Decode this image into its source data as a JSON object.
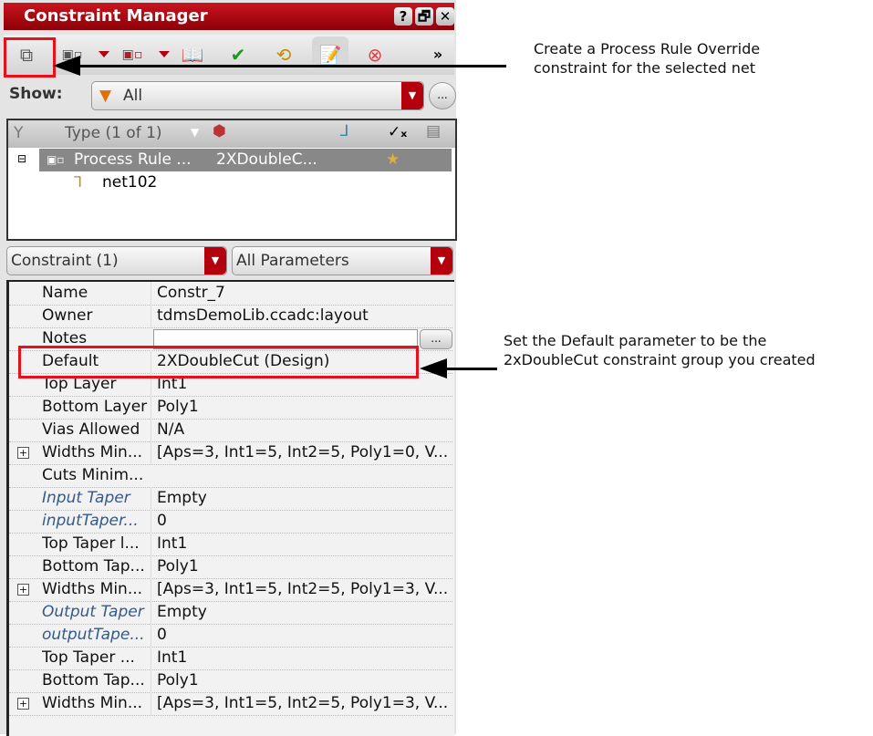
{
  "window": {
    "title": "Constraint Manager",
    "buttons": [
      "?",
      "🗗",
      "✕"
    ]
  },
  "toolbar": {
    "items": [
      "copy-constraint-icon",
      "constraint-group-icon",
      "constraint-group-alt-icon",
      "book-icon",
      "check-icon",
      "refresh-icon",
      "edit-icon",
      "cancel-icon"
    ],
    "overflow": "»"
  },
  "show": {
    "label": "Show:",
    "value": "All",
    "ellipsis": "..."
  },
  "tree": {
    "header": {
      "type": "Type (1 of 1)"
    },
    "row": {
      "type": "Process Rule ...",
      "value": "2XDoubleC..."
    },
    "child": "net102"
  },
  "filters": {
    "left": "Constraint (1)",
    "right": "All Parameters"
  },
  "params": [
    {
      "name": "Name",
      "value": "Constr_7"
    },
    {
      "name": "Owner",
      "value": "tdmsDemoLib.ccadc:layout"
    },
    {
      "name": "Notes",
      "value": "",
      "button": "..."
    },
    {
      "name": "Default",
      "value": "2XDoubleCut (Design)"
    },
    {
      "name": "Top Layer",
      "value": "Int1"
    },
    {
      "name": "Bottom Layer",
      "value": "Poly1"
    },
    {
      "name": "Vias Allowed",
      "value": "N/A"
    },
    {
      "name": "Widths Min...",
      "value": "[Aps=3, Int1=5, Int2=5, Poly1=0, V...",
      "expand": true
    },
    {
      "name": "Cuts Minim...",
      "value": ""
    },
    {
      "name": "Input Taper",
      "value": "Empty",
      "italic": true
    },
    {
      "name": "inputTaper...",
      "value": "0",
      "italic": true
    },
    {
      "name": "Top Taper l...",
      "value": "Int1"
    },
    {
      "name": "Bottom Tap...",
      "value": "Poly1"
    },
    {
      "name": "Widths Min...",
      "value": "[Aps=3, Int1=5, Int2=5, Poly1=3, V...",
      "expand": true
    },
    {
      "name": "Output Taper",
      "value": "Empty",
      "italic": true
    },
    {
      "name": "outputTape...",
      "value": "0",
      "italic": true
    },
    {
      "name": "Top Taper ...",
      "value": "Int1"
    },
    {
      "name": "Bottom Tap...",
      "value": "Poly1"
    },
    {
      "name": "Widths Min...",
      "value": "[Aps=3, Int1=5, Int2=5, Poly1=3, V...",
      "expand": true
    }
  ],
  "annotations": {
    "first": [
      "Create a Process Rule Override",
      "constraint for the selected net"
    ],
    "second": [
      "Set the Default parameter to be the",
      "2xDoubleCut constraint group you created"
    ]
  },
  "colors": {
    "accent": "#b4000c",
    "highlight": "#e8101a"
  }
}
